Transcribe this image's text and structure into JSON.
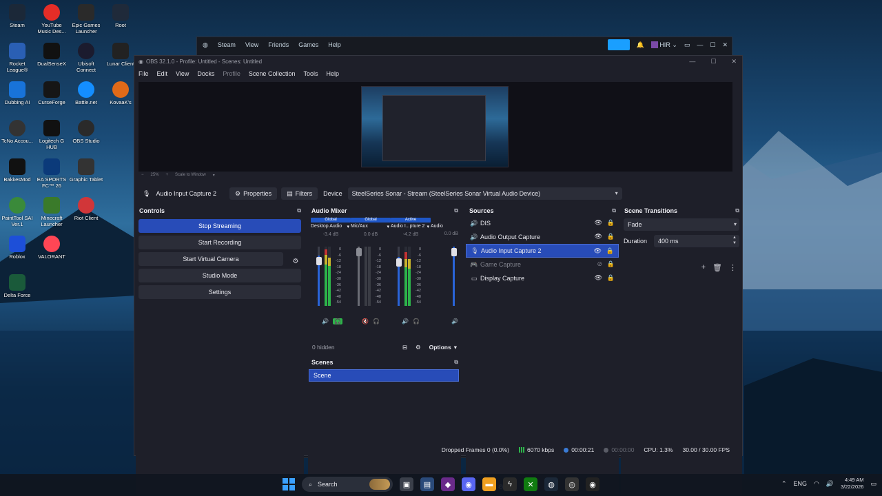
{
  "desktop": {
    "icons": [
      {
        "label": "Steam",
        "color": "#1b2838"
      },
      {
        "label": "YouTube Music Des...",
        "color": "#e52d27"
      },
      {
        "label": "Epic Games Launcher",
        "color": "#2a2a2a"
      },
      {
        "label": "Root",
        "color": "#1f2a3a"
      },
      {
        "label": "Rocket League®",
        "color": "#2a5fb4"
      },
      {
        "label": "DualSenseX",
        "color": "#111111"
      },
      {
        "label": "Ubisoft Connect",
        "color": "#1b1b2e"
      },
      {
        "label": "Lunar Client",
        "color": "#222222"
      },
      {
        "label": "Dubbing AI",
        "color": "#1873d9"
      },
      {
        "label": "CurseForge",
        "color": "#161616"
      },
      {
        "label": "Battle.net",
        "color": "#148eff"
      },
      {
        "label": "KovaaK's",
        "color": "#e06a18"
      },
      {
        "label": "TcNo Accou...",
        "color": "#333333"
      },
      {
        "label": "Logitech G HUB",
        "color": "#111111"
      },
      {
        "label": "OBS Studio",
        "color": "#2a2a2a"
      },
      {
        "label": "BakkesMod",
        "color": "#111111"
      },
      {
        "label": "EA SPORTS FC™ 26",
        "color": "#0b3a7a"
      },
      {
        "label": "Graphic Tablet",
        "color": "#333333"
      },
      {
        "label": "PaintTool SAI Ver.1",
        "color": "#3a8a3a"
      },
      {
        "label": "Minecraft Launcher",
        "color": "#3a7a2a"
      },
      {
        "label": "Riot Client",
        "color": "#d13639"
      },
      {
        "label": "Roblox",
        "color": "#1d4fd8"
      },
      {
        "label": "VALORANT",
        "color": "#ff4655"
      },
      {
        "label": "Delta Force",
        "color": "#1a5a3a"
      }
    ]
  },
  "steam": {
    "menu": [
      "Steam",
      "View",
      "Friends",
      "Games",
      "Help"
    ],
    "user": "HIR"
  },
  "obs": {
    "title": "OBS 32.1.0 - Profile: Untitled - Scenes: Untitled",
    "menu": {
      "file": "File",
      "edit": "Edit",
      "view": "View",
      "docks": "Docks",
      "profile": "Profile",
      "scene_collection": "Scene Collection",
      "tools": "Tools",
      "help": "Help"
    },
    "zoom": {
      "level": "25%",
      "scale": "Scale to Window"
    },
    "source_toolbar": {
      "source_name": "Audio Input Capture 2",
      "properties": "Properties",
      "filters": "Filters",
      "device_label": "Device",
      "device_value": "SteelSeries Sonar - Stream (SteelSeries Sonar Virtual Audio Device)"
    },
    "controls": {
      "title": "Controls",
      "stop_streaming": "Stop Streaming",
      "start_recording": "Start Recording",
      "start_virtual_camera": "Start Virtual Camera",
      "studio_mode": "Studio Mode",
      "settings": "Settings"
    },
    "mixer": {
      "title": "Audio Mixer",
      "channels": [
        {
          "tag": "Global",
          "tag_color": "#1f57c8",
          "name": "Desktop Audio",
          "db": "-3.4 dB",
          "volume": 0.85
        },
        {
          "tag": "Global",
          "tag_color": "#1f57c8",
          "name": "Mic/Aux",
          "db": "0.0 dB",
          "volume": 1.0
        },
        {
          "tag": "Active",
          "tag_color": "#1f57c8",
          "name": "Audio I...pture 2",
          "db": "-4.2 dB",
          "volume": 0.83
        },
        {
          "tag": "",
          "tag_color": "#1f57c8",
          "name": "Audio",
          "db": "0.0 dB",
          "volume": 1.0
        }
      ],
      "ticks": [
        "0",
        "-6",
        "-12",
        "-18",
        "-24",
        "-30",
        "-36",
        "-42",
        "-48",
        "-54",
        "-60"
      ],
      "hidden": "0 hidden",
      "options": "Options"
    },
    "scenes": {
      "title": "Scenes",
      "items": [
        "Scene"
      ]
    },
    "sources": {
      "title": "Sources",
      "items": [
        {
          "name": "DIS",
          "icon": "speaker-icon",
          "selected": false,
          "dim": false
        },
        {
          "name": "Audio Output Capture",
          "icon": "speaker-icon",
          "selected": false,
          "dim": false
        },
        {
          "name": "Audio Input Capture 2",
          "icon": "microphone-icon",
          "selected": true,
          "dim": false
        },
        {
          "name": "Game Capture",
          "icon": "gamepad-icon",
          "selected": false,
          "dim": true
        },
        {
          "name": "Display Capture",
          "icon": "monitor-icon",
          "selected": false,
          "dim": false
        }
      ]
    },
    "transitions": {
      "title": "Scene Transitions",
      "type": "Fade",
      "duration_label": "Duration",
      "duration_value": "400 ms"
    },
    "status": {
      "dropped_frames": "Dropped Frames 0 (0.0%)",
      "bitrate": "6070 kbps",
      "stream_time": "00:00:21",
      "record_time": "00:00:00",
      "cpu": "CPU: 1.3%",
      "fps": "30.00 / 30.00 FPS"
    }
  },
  "taskbar": {
    "search": "Search",
    "language": "ENG",
    "time": "4:49 AM",
    "date": "3/22/2026"
  },
  "colors": {
    "accent": "#284cb8",
    "panel": "#1e1f29",
    "button": "#2b2d38"
  }
}
